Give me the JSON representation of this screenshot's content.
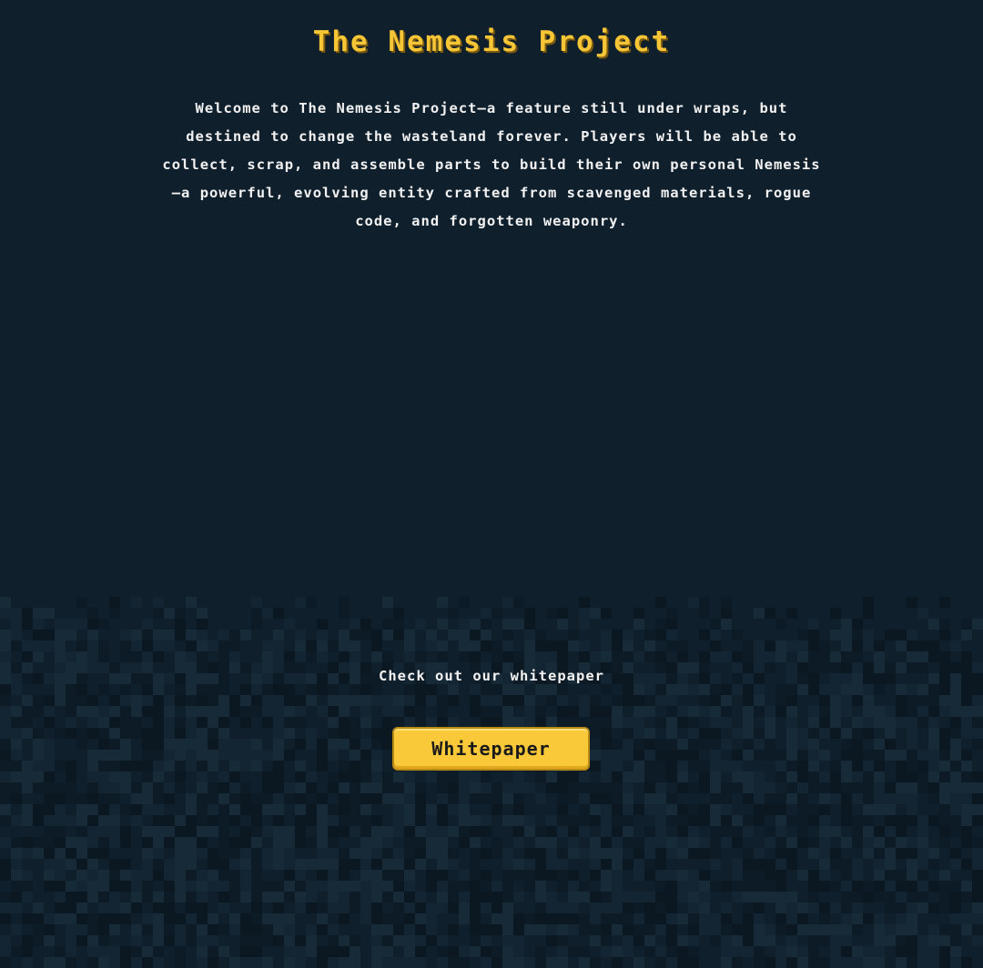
{
  "header": {
    "title": "The Nemesis Project"
  },
  "intro": {
    "text": "Welcome to The Nemesis Project—a feature still under wraps, but destined to change the wasteland forever. Players will be able to collect, scrap, and assemble parts to build their own personal Nemesis—a powerful, evolving entity crafted from scavenged materials, rogue code, and forgotten weaponry."
  },
  "cta": {
    "text": "Check out our whitepaper",
    "button_label": "Whitepaper"
  },
  "colors": {
    "background": "#0f1f2c",
    "title": "#f7c637",
    "text": "#f2f2f2",
    "button": "#f9c93a"
  }
}
